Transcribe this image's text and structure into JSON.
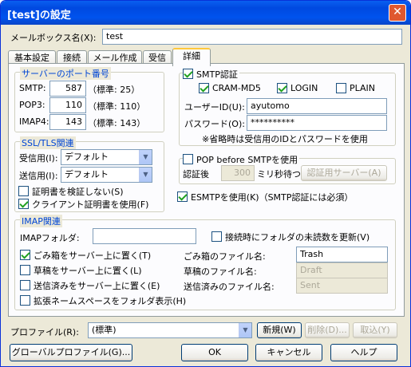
{
  "window": {
    "title": "[test]の設定",
    "close_glyph": "✕"
  },
  "mailbox": {
    "label": "メールボックス名(X):",
    "value": "test"
  },
  "tabs": [
    "基本設定",
    "接続",
    "メール作成",
    "受信",
    "詳細"
  ],
  "ports": {
    "title": "サーバーのポート番号",
    "smtp": {
      "label": "SMTP:",
      "value": "587",
      "note": "（標準: 25）"
    },
    "pop3": {
      "label": "POP3:",
      "value": "110",
      "note": "（標準: 110）"
    },
    "imap4": {
      "label": "IMAP4:",
      "value": "143",
      "note": "（標準: 143）"
    }
  },
  "ssl": {
    "title": "SSL/TLS関連",
    "receive_label": "受信用(I):",
    "receive_value": "デフォルト",
    "send_label": "送信用(I):",
    "send_value": "デフォルト",
    "no_verify_label": "証明書を検証しない(S)",
    "client_cert_label": "クライアント証明書を使用(F)"
  },
  "smtp_auth": {
    "title": "SMTP認証",
    "cram_md5": "CRAM-MD5",
    "login": "LOGIN",
    "plain": "PLAIN",
    "user_label": "ユーザーID(U):",
    "user_value": "ayutomo",
    "password_label": "パスワード(O):",
    "password_value": "**********",
    "note": "※省略時は受信用のIDとパスワードを使用"
  },
  "pop_before": {
    "title": "POP before SMTPを使用",
    "after_label": "認証後",
    "ms_value": "300",
    "ms_label": "ミリ秒待つ",
    "server_button": "認証用サーバー(A)"
  },
  "esmtp_label": "ESMTPを使用(K)（SMTP認証には必須）",
  "imap": {
    "title": "IMAP関連",
    "folder_label": "IMAPフォルダ:",
    "folder_value": "",
    "update_unread_label": "接続時にフォルダの未読数を更新(V)",
    "trash_on_server": "ごみ箱をサーバー上に置く(T)",
    "drafts_on_server": "草稿をサーバー上に置く(L)",
    "sent_on_server": "送信済みをサーバー上に置く(E)",
    "ext_namespace": "拡張ネームスペースをフォルダ表示(H)",
    "trash_file_label": "ごみ箱のファイル名:",
    "trash_file_value": "Trash",
    "draft_file_label": "草稿のファイル名:",
    "draft_file_value": "Draft",
    "sent_file_label": "送信済みのファイル名:",
    "sent_file_value": "Sent"
  },
  "profile": {
    "label": "プロファイル(R):",
    "value": "(標準)",
    "new_button": "新規(W)",
    "delete_button": "削除(D)...",
    "cancel_button": "取込(Y)"
  },
  "footer": {
    "global_profile": "グローバルプロファイル(G)...",
    "ok": "OK",
    "cancel": "キャンセル",
    "help": "ヘルプ"
  }
}
